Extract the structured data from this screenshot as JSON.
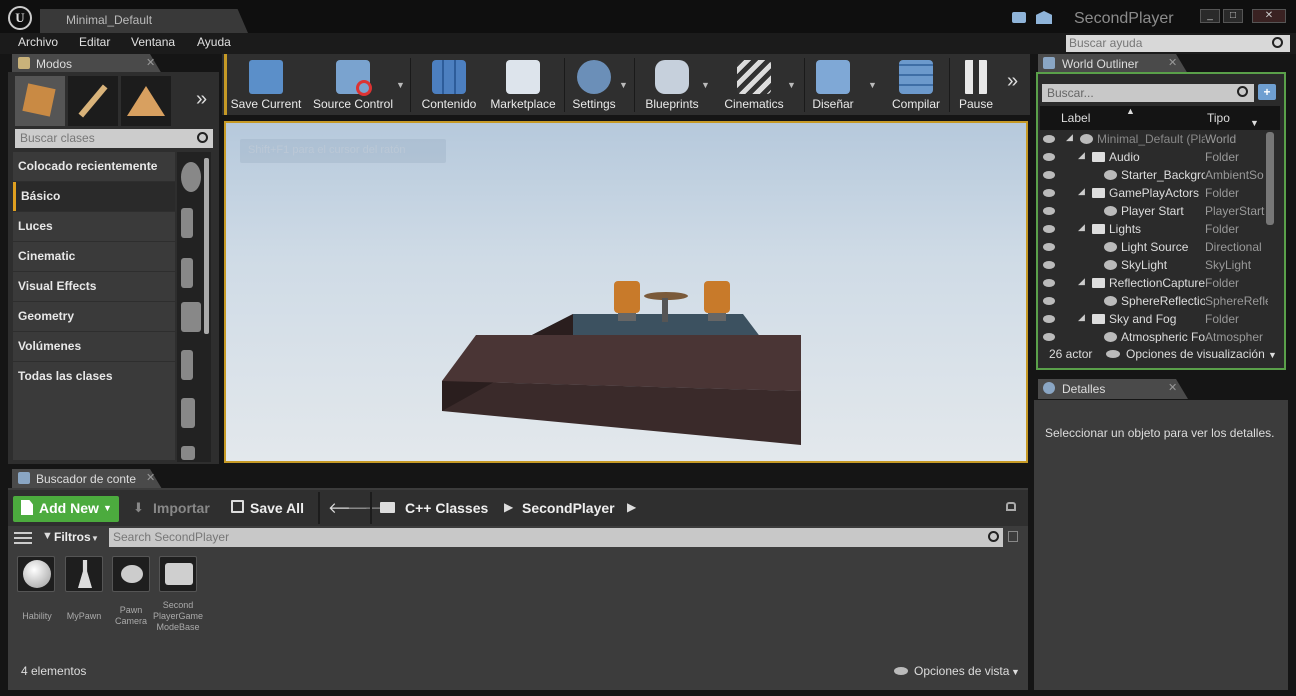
{
  "title_bar": {
    "engine_logo": "U",
    "document_tab": "Minimal_Default",
    "project_name": "SecondPlayer",
    "icons": [
      "chat-icon",
      "marketplace-icon"
    ],
    "window_controls": [
      "_",
      "□",
      "✕"
    ]
  },
  "menubar": {
    "items": [
      "Archivo",
      "Editar",
      "Ventana",
      "Ayuda"
    ],
    "search_placeholder": "Buscar ayuda"
  },
  "modes_panel": {
    "tab_label": "Modos",
    "mode_icons": [
      "place-icon",
      "paint-icon",
      "landscape-icon"
    ],
    "search_placeholder": "Buscar clases",
    "categories": [
      "Colocado recientemente",
      "Básico",
      "Luces",
      "Cinematic",
      "Visual Effects",
      "Geometry",
      "Volúmenes",
      "Todas las clases"
    ],
    "selected_category": "Básico"
  },
  "toolbar": {
    "buttons": [
      {
        "label": "Save Current",
        "icon": "save-icon"
      },
      {
        "label": "Source Control",
        "icon": "source-control-icon"
      },
      {
        "label": "Contenido",
        "icon": "content-icon"
      },
      {
        "label": "Marketplace",
        "icon": "marketplace-bag-icon"
      },
      {
        "label": "Settings",
        "icon": "settings-icon"
      },
      {
        "label": "Blueprints",
        "icon": "blueprints-icon"
      },
      {
        "label": "Cinematics",
        "icon": "clapper-icon"
      },
      {
        "label": "Diseñar",
        "icon": "build-icon"
      },
      {
        "label": "Compilar",
        "icon": "compile-icon"
      },
      {
        "label": "Pause",
        "icon": "pause-icon"
      }
    ]
  },
  "viewport": {
    "hint": "Shift+F1 para el cursor del ratón"
  },
  "world_outliner": {
    "tab_label": "World Outliner",
    "search_placeholder": "Buscar...",
    "col_label": "Label",
    "col_type": "Tipo",
    "rows": [
      {
        "label": "Minimal_Default (Pla",
        "type": "World",
        "depth": 0,
        "icon": "world-icon"
      },
      {
        "label": "Audio",
        "type": "Folder",
        "depth": 1,
        "icon": "folder-icon"
      },
      {
        "label": "Starter_Backgrou",
        "type": "AmbientSo",
        "depth": 2,
        "icon": "ambient-sound-icon"
      },
      {
        "label": "GamePlayActors",
        "type": "Folder",
        "depth": 1,
        "icon": "folder-icon"
      },
      {
        "label": "Player Start",
        "type": "PlayerStart",
        "depth": 2,
        "icon": "player-start-icon"
      },
      {
        "label": "Lights",
        "type": "Folder",
        "depth": 1,
        "icon": "folder-icon"
      },
      {
        "label": "Light Source",
        "type": "Directional",
        "depth": 2,
        "icon": "light-icon"
      },
      {
        "label": "SkyLight",
        "type": "SkyLight",
        "depth": 2,
        "icon": "skylight-icon"
      },
      {
        "label": "ReflectionCapture",
        "type": "Folder",
        "depth": 1,
        "icon": "folder-icon"
      },
      {
        "label": "SphereReflectio",
        "type": "SphereRefle",
        "depth": 2,
        "icon": "reflection-icon"
      },
      {
        "label": "Sky and Fog",
        "type": "Folder",
        "depth": 1,
        "icon": "folder-icon"
      },
      {
        "label": "Atmospheric Fo",
        "type": "Atmospher",
        "depth": 2,
        "icon": "fog-icon"
      }
    ],
    "actor_count": "26 actor",
    "view_options": "Opciones de visualización"
  },
  "details": {
    "tab_label": "Detalles",
    "empty_message": "Seleccionar un objeto para ver los detalles."
  },
  "content_browser": {
    "tab_label": "Buscador de conte",
    "add_new": "Add New",
    "import": "Importar",
    "save_all": "Save All",
    "path": [
      "C++ Classes",
      "SecondPlayer"
    ],
    "filters": "Filtros",
    "search_placeholder": "Search SecondPlayer",
    "assets": [
      {
        "line1": "Hability",
        "line2": "",
        "line3": "",
        "icon": "sphere-icon"
      },
      {
        "line1": "MyPawn",
        "line2": "",
        "line3": "",
        "icon": "pawn-icon"
      },
      {
        "line1": "Pawn",
        "line2": "Camera",
        "line3": "",
        "icon": "camera-pawn-icon"
      },
      {
        "line1": "Second",
        "line2": "PlayerGame",
        "line3": "ModeBase",
        "icon": "gamemode-icon"
      }
    ],
    "count": "4 elementos",
    "view_options": "Opciones de vista"
  }
}
